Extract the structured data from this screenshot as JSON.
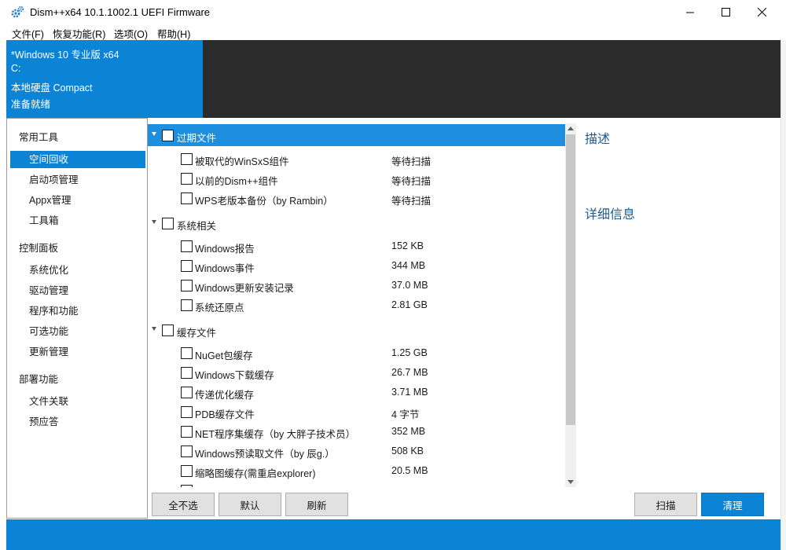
{
  "window": {
    "title": "Dism++x64 10.1.1002.1 UEFI Firmware"
  },
  "menu": [
    "文件(F)",
    "恢复功能(R)",
    "选项(O)",
    "帮助(H)"
  ],
  "banner": {
    "lines": [
      "*Windows 10 专业版 x64",
      "C:",
      "本地硬盘 Compact",
      "准备就绪"
    ]
  },
  "sidebar": {
    "sections": [
      {
        "title": "常用工具",
        "items": [
          "空间回收",
          "启动项管理",
          "Appx管理",
          "工具箱"
        ]
      },
      {
        "title": "控制面板",
        "items": [
          "系统优化",
          "驱动管理",
          "程序和功能",
          "可选功能",
          "更新管理"
        ]
      },
      {
        "title": "部署功能",
        "items": [
          "文件关联",
          "预应答"
        ]
      }
    ],
    "selected_item": "空间回收"
  },
  "tree": {
    "groups": [
      {
        "label": "过期文件",
        "selected": true,
        "rows": [
          {
            "name": "被取代的WinSxS组件",
            "size": "等待扫描"
          },
          {
            "name": "以前的Dism++组件",
            "size": "等待扫描"
          },
          {
            "name": "WPS老版本备份（by Rambin）",
            "size": "等待扫描"
          }
        ]
      },
      {
        "label": "系统相关",
        "selected": false,
        "rows": [
          {
            "name": "Windows报告",
            "size": "152 KB"
          },
          {
            "name": "Windows事件",
            "size": "344 MB"
          },
          {
            "name": "Windows更新安装记录",
            "size": "37.0 MB"
          },
          {
            "name": "系统还原点",
            "size": "2.81 GB"
          }
        ]
      },
      {
        "label": "缓存文件",
        "selected": false,
        "rows": [
          {
            "name": "NuGet包缓存",
            "size": "1.25 GB"
          },
          {
            "name": "Windows下载缓存",
            "size": "26.7 MB"
          },
          {
            "name": "传递优化缓存",
            "size": "3.71 MB"
          },
          {
            "name": "PDB缓存文件",
            "size": "4 字节"
          },
          {
            "name": "NET程序集缓存（by 大胖子技术员）",
            "size": "352 MB"
          },
          {
            "name": "Windows预读取文件（by 辰g.）",
            "size": "508 KB"
          },
          {
            "name": "缩略图缓存(需重启explorer)",
            "size": "20.5 MB"
          }
        ]
      }
    ]
  },
  "scrollbar": {
    "thumb_fraction": 0.85
  },
  "info_panel": {
    "description_title": "描述",
    "details_title": "详细信息"
  },
  "buttons": {
    "deselect_all": "全不选",
    "default": "默认",
    "refresh": "刷新",
    "scan": "扫描",
    "clean": "清理"
  },
  "colors": {
    "accent": "#0c84d6",
    "selected_row": "#1e8fde",
    "banner_dark": "#2b2b2b",
    "heading": "#1f5c8c"
  }
}
